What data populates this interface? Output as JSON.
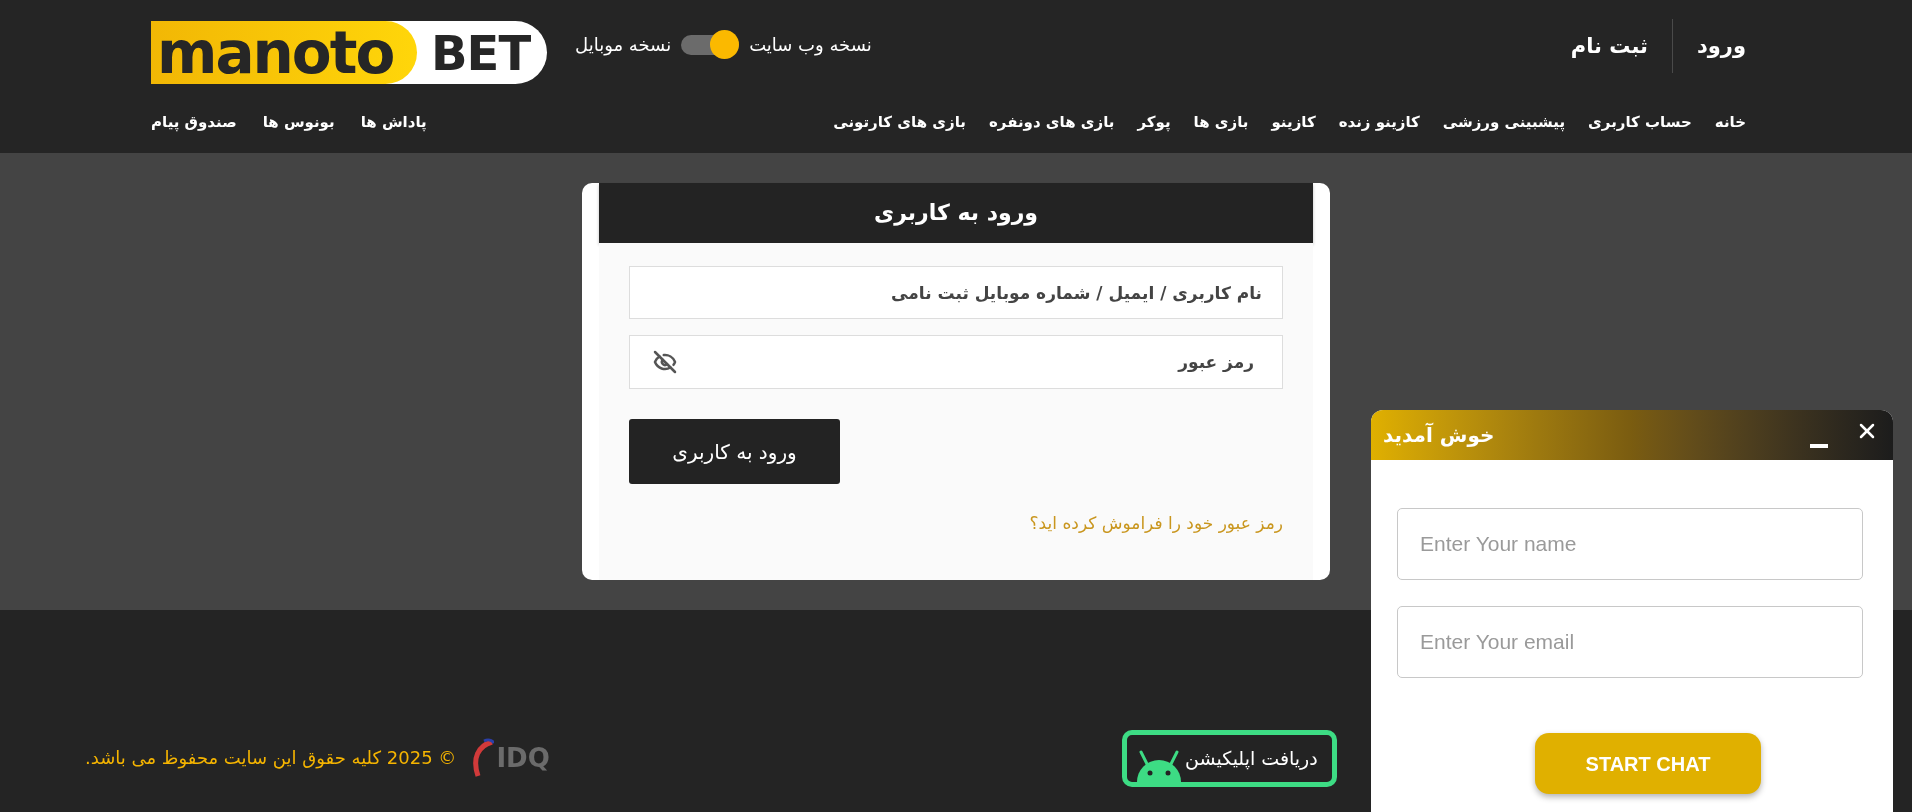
{
  "header": {
    "logo": {
      "wordmark": "manoto",
      "suffix": "BET"
    },
    "version_switch": {
      "labels": [
        "نسخه وب سایت",
        "نسخه موبایل"
      ],
      "mobile_selected": false
    },
    "auth_links": [
      "ورود",
      "ثبت نام"
    ]
  },
  "main_nav": [
    "خانه",
    "حساب کاربری",
    "پیشبینی ورزشی",
    "کازینو زنده",
    "کازینو",
    "بازی ها",
    "پوکر",
    "بازی های دونفره",
    "بازی های کارتونی"
  ],
  "secondary_nav": [
    "پاداش ها",
    "بونوس ها",
    "صندوق پیام"
  ],
  "login_form": {
    "title": "ورود به کاربری",
    "username": {
      "placeholder": "نام کاربری / ایمیل / شماره موبایل ثبت نامی"
    },
    "password": {
      "placeholder": "رمز عبور",
      "visible": false
    },
    "submit": "ورود به کاربری",
    "forgot_link": "رمز عبور خود را فراموش کرده اید؟"
  },
  "footer": {
    "copyright": "© 2025 کلیه حقوق این سایت محفوظ می باشد.",
    "partner_logo": "IDQ",
    "app_button": "دریافت اپلیکیشن"
  },
  "chat_widget": {
    "title": "خوش آمدید",
    "name_field": {
      "placeholder": "Enter Your name"
    },
    "email_field": {
      "placeholder": "Enter Your email"
    },
    "start_button": "START CHAT"
  }
}
